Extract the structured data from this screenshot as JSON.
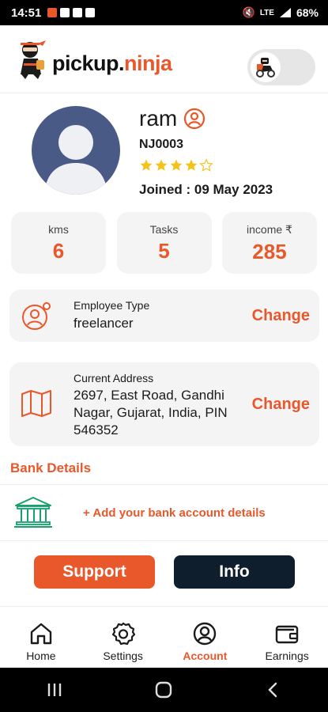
{
  "status_bar": {
    "time": "14:51",
    "battery": "68%",
    "network": "LTE"
  },
  "brand": {
    "name_part1": "pickup",
    "name_dot": ".",
    "name_part2": "ninja",
    "accent": "#e8582b",
    "dark": "#0e1e2c"
  },
  "profile": {
    "name": "ram",
    "id": "NJ0003",
    "rating": 4,
    "rating_max": 5,
    "joined": "Joined : 09 May 2023"
  },
  "stats": [
    {
      "label": "kms",
      "value": "6"
    },
    {
      "label": "Tasks",
      "value": "5"
    },
    {
      "label": "income ₹",
      "value": "285"
    }
  ],
  "employee": {
    "title": "Employee Type",
    "value": "freelancer",
    "action": "Change"
  },
  "address": {
    "title": "Current Address",
    "line1": "2697, East Road, Gandhi",
    "line2": "Nagar, Gujarat, India, PIN",
    "line3": "546352",
    "action": "Change"
  },
  "bank": {
    "title": "Bank Details",
    "add_label": "+ Add your bank account details"
  },
  "buttons": {
    "support": "Support",
    "info": "Info"
  },
  "nav": [
    {
      "label": "Home",
      "icon": "home-icon",
      "active": false
    },
    {
      "label": "Settings",
      "icon": "gear-icon",
      "active": false
    },
    {
      "label": "Account",
      "icon": "account-icon",
      "active": true
    },
    {
      "label": "Earnings",
      "icon": "wallet-icon",
      "active": false
    }
  ]
}
